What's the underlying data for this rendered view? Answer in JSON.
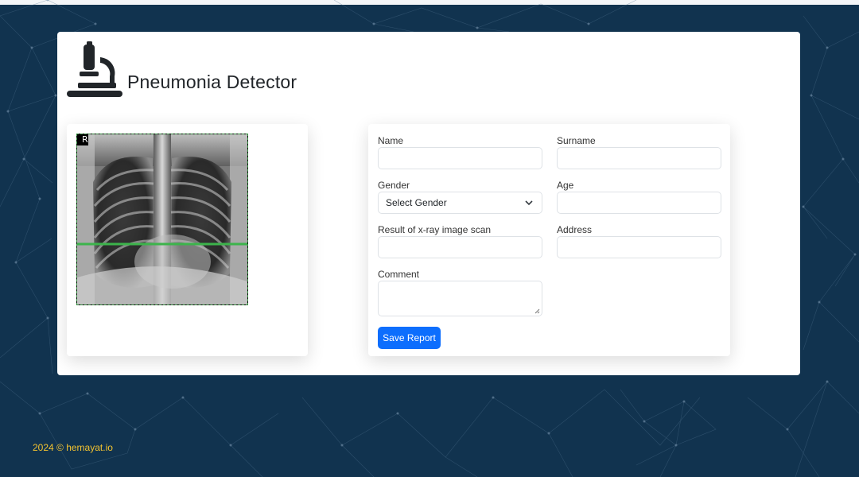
{
  "header": {
    "title": "Pneumonia Detector",
    "logo_icon": "microscope-icon"
  },
  "scan": {
    "side_marker": "R",
    "marker_line_color": "#3cb44b"
  },
  "form": {
    "name": {
      "label": "Name",
      "value": ""
    },
    "surname": {
      "label": "Surname",
      "value": ""
    },
    "gender": {
      "label": "Gender",
      "selected": "Select Gender"
    },
    "age": {
      "label": "Age",
      "value": ""
    },
    "result": {
      "label": "Result of x-ray image scan",
      "value": ""
    },
    "address": {
      "label": "Address",
      "value": ""
    },
    "comment": {
      "label": "Comment",
      "value": ""
    },
    "save_label": "Save Report"
  },
  "footer": {
    "text": "2024 © hemayat.io"
  },
  "colors": {
    "background": "#11334f",
    "primary_button": "#0d6efd",
    "footer_text": "#f2c230",
    "title_text": "#212529"
  }
}
